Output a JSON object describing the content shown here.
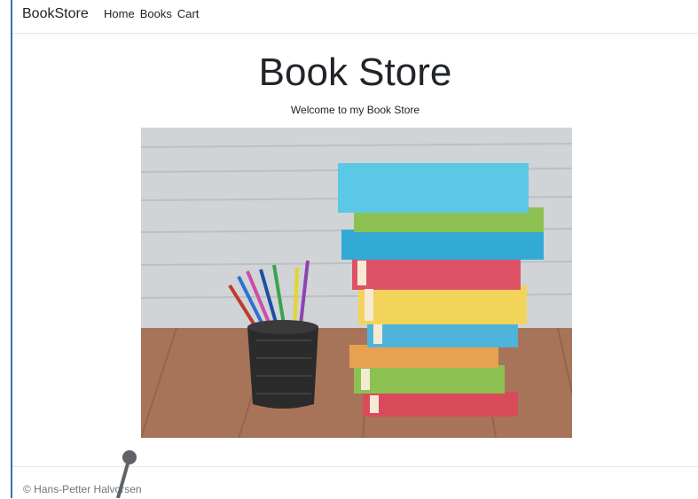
{
  "navbar": {
    "brand": "BookStore",
    "links": [
      "Home",
      "Books",
      "Cart"
    ]
  },
  "hero": {
    "title": "Book Store",
    "subtitle": "Welcome to my Book Store"
  },
  "footer": {
    "text": "© Hans-Petter Halvorsen"
  },
  "colors": {
    "left_rule": "#3f6db3",
    "footer_text": "#6c757d"
  }
}
